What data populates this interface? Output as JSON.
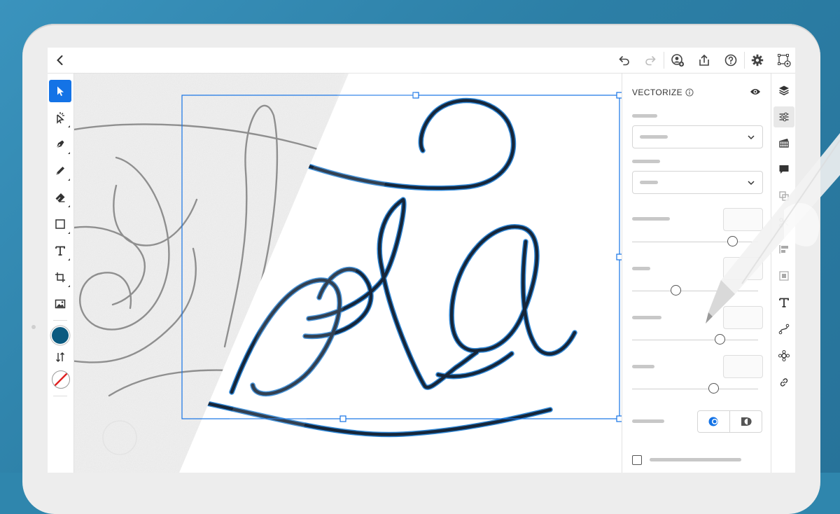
{
  "colors": {
    "accent": "#1473e6",
    "fill_swatch": "#0b5a80",
    "vector_stroke": "#16263a",
    "vector_outline": "#2f87d6",
    "pencil": "#8a8a8a"
  },
  "topbar": {
    "back_icon": "chevron-left-icon",
    "icons": [
      "undo-icon",
      "redo-icon",
      "invite-user-icon",
      "share-icon",
      "help-icon",
      "settings-icon",
      "vector-preview-icon"
    ]
  },
  "tools": [
    {
      "icon": "selection-arrow-icon",
      "active": true
    },
    {
      "icon": "direct-selection-icon",
      "active": false
    },
    {
      "icon": "pen-icon",
      "active": false
    },
    {
      "icon": "pencil-icon",
      "active": false
    },
    {
      "icon": "eraser-icon",
      "active": false
    },
    {
      "icon": "rectangle-icon",
      "active": false
    },
    {
      "icon": "type-icon",
      "active": false
    },
    {
      "icon": "crop-icon",
      "active": false
    },
    {
      "icon": "place-image-icon",
      "active": false
    }
  ],
  "panel": {
    "title": "VECTORIZE",
    "sliders": [
      {
        "level": 0.8
      },
      {
        "level": 0.35
      },
      {
        "level": 0.7
      },
      {
        "level": 0.65
      }
    ]
  },
  "rail": [
    "layers-icon",
    "properties-icon",
    "swatches-icon",
    "comments-icon",
    "repeat-icon",
    "scissors-icon",
    "align-icon",
    "transform-icon",
    "type-icon",
    "path-icon",
    "shape-icon",
    "link-icon"
  ]
}
